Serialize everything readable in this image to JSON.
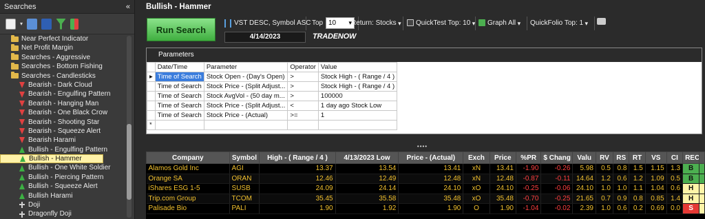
{
  "left_panel": {
    "title": "Searches",
    "collapse_label": "«",
    "tree": [
      {
        "label": "Near Perfect Indicator",
        "icon": "folder"
      },
      {
        "label": "Net Profit Margin",
        "icon": "folder"
      },
      {
        "label": "Searches - Aggressive",
        "icon": "folder"
      },
      {
        "label": "Searches - Bottom Fishing",
        "icon": "folder"
      },
      {
        "label": "Searches - Candlesticks",
        "icon": "folder"
      },
      {
        "label": "Bearish - Dark Cloud",
        "icon": "bear"
      },
      {
        "label": "Bearish - Engulfing Pattern",
        "icon": "bear"
      },
      {
        "label": "Bearish - Hanging Man",
        "icon": "bear"
      },
      {
        "label": "Bearish - One Black Crow",
        "icon": "bear"
      },
      {
        "label": "Bearish - Shooting Star",
        "icon": "bear"
      },
      {
        "label": "Bearish - Squeeze Alert",
        "icon": "bear"
      },
      {
        "label": "Bearish Harami",
        "icon": "bear"
      },
      {
        "label": "Bullish - Engulfing Pattern",
        "icon": "bull"
      },
      {
        "label": "Bullish - Hammer",
        "icon": "bull",
        "selected": true
      },
      {
        "label": "Bullish - One White Soldier",
        "icon": "bull"
      },
      {
        "label": "Bullish - Piercing Pattern",
        "icon": "bull"
      },
      {
        "label": "Bullish - Squeeze Alert",
        "icon": "bull"
      },
      {
        "label": "Bullish Harami",
        "icon": "bull"
      },
      {
        "label": "Doji",
        "icon": "doji"
      },
      {
        "label": "Dragonfly Doji",
        "icon": "doji"
      }
    ]
  },
  "search": {
    "title": "Bullish - Hammer",
    "run_label": "Run Search",
    "sort_label": "VST DESC, Symbol ASC",
    "date": "4/14/2023",
    "brand": "TRADENOW",
    "top_label": "Top",
    "top_value": "10",
    "return_label": "Return: Stocks",
    "quicktest_label": "QuickTest Top: 10",
    "graph_label": "Graph All",
    "quickfolio_label": "QuickFolio Top: 1"
  },
  "parameters": {
    "header": "Parameters",
    "columns": [
      "Date/Time",
      "Parameter",
      "Operator",
      "Value"
    ],
    "rows": [
      [
        "Time of Search",
        "Stock Open - (Day's Open)",
        ">",
        "Stock High -  ( Range / 4 )"
      ],
      [
        "Time of Search",
        "Stock Price - (Split Adjust...",
        ">",
        "Stock High -  ( Range / 4 )"
      ],
      [
        "Time of Search",
        "Stock AvgVol - (50 day m...",
        ">",
        "100000"
      ],
      [
        "Time of Search",
        "Stock Price - (Split Adjust...",
        "<",
        "1 day ago Stock Low"
      ],
      [
        "Time of Search",
        "Stock Price - (Actual)",
        ">=",
        "1"
      ]
    ]
  },
  "results": {
    "columns": [
      "Company",
      "Symbol",
      "High -  ( Range / 4 )",
      "4/13/2023 Low",
      "Price - (Actual)",
      "Exch",
      "Price",
      "%PR",
      "$ Chang",
      "Valu",
      "RV",
      "RS",
      "RT",
      "VS",
      "CI",
      "REC"
    ],
    "rows": [
      [
        "Alamos Gold Inc",
        "AGI",
        "13.37",
        "13.54",
        "13.41",
        "xN",
        "13.41",
        "-1.90",
        "-0.26",
        "5.98",
        "0.5",
        "0.8",
        "1.5",
        "1.15",
        "1.3",
        "B"
      ],
      [
        "Orange SA",
        "ORAN",
        "12.46",
        "12.49",
        "12.48",
        "xN",
        "12.48",
        "-0.87",
        "-0.11",
        "14.64",
        "1.2",
        "0.6",
        "1.2",
        "1.09",
        "0.5",
        "B"
      ],
      [
        "iShares ESG 1-5",
        "SUSB",
        "24.09",
        "24.14",
        "24.10",
        "xO",
        "24.10",
        "-0.25",
        "-0.06",
        "24.10",
        "1.0",
        "1.0",
        "1.1",
        "1.04",
        "0.6",
        "H"
      ],
      [
        "Trip.com Group",
        "TCOM",
        "35.45",
        "35.58",
        "35.48",
        "xO",
        "35.48",
        "-0.70",
        "-0.25",
        "21.65",
        "0.7",
        "0.9",
        "0.8",
        "0.85",
        "1.4",
        "H"
      ],
      [
        "Palisade Bio",
        "PALI",
        "1.90",
        "1.92",
        "1.90",
        "O",
        "1.90",
        "-1.04",
        "-0.02",
        "2.39",
        "1.0",
        "0.6",
        "0.2",
        "0.69",
        "0.0",
        "S"
      ]
    ]
  },
  "colors": {
    "run_green": "#3fae3f",
    "row_text": "#f2c12e",
    "negative": "#ff4040",
    "selected": "#fff2a8"
  }
}
